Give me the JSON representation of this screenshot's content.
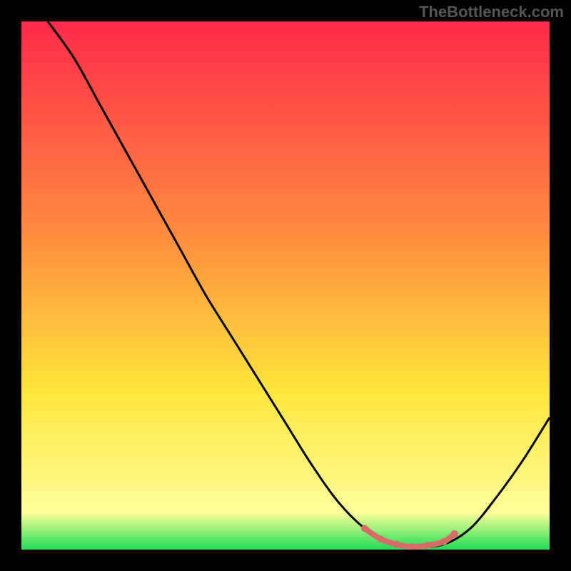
{
  "watermark": "TheBottleneck.com",
  "chart_data": {
    "type": "line",
    "title": "",
    "xlabel": "",
    "ylabel": "",
    "xlim": [
      0,
      100
    ],
    "ylim": [
      0,
      100
    ],
    "background_gradient": {
      "top": "#ff2a4a",
      "mid_orange": "#ff8b3e",
      "mid_yellow": "#ffe63c",
      "pale_yellow": "#ffff99",
      "bottom": "#1edd55"
    },
    "series": [
      {
        "name": "bottleneck-curve",
        "color": "#000000",
        "points": [
          {
            "x": 5,
            "y": 100
          },
          {
            "x": 10,
            "y": 93
          },
          {
            "x": 15,
            "y": 84
          },
          {
            "x": 20,
            "y": 75
          },
          {
            "x": 25,
            "y": 66
          },
          {
            "x": 30,
            "y": 57
          },
          {
            "x": 35,
            "y": 48
          },
          {
            "x": 40,
            "y": 40
          },
          {
            "x": 45,
            "y": 32
          },
          {
            "x": 50,
            "y": 24
          },
          {
            "x": 55,
            "y": 16
          },
          {
            "x": 60,
            "y": 9
          },
          {
            "x": 65,
            "y": 4
          },
          {
            "x": 70,
            "y": 1
          },
          {
            "x": 75,
            "y": 0.5
          },
          {
            "x": 80,
            "y": 1
          },
          {
            "x": 85,
            "y": 4
          },
          {
            "x": 90,
            "y": 10
          },
          {
            "x": 95,
            "y": 17
          },
          {
            "x": 100,
            "y": 25
          }
        ]
      },
      {
        "name": "optimal-zone",
        "color": "#d96a6a",
        "points": [
          {
            "x": 65,
            "y": 4
          },
          {
            "x": 68,
            "y": 2
          },
          {
            "x": 71,
            "y": 1
          },
          {
            "x": 74,
            "y": 0.5
          },
          {
            "x": 77,
            "y": 0.8
          },
          {
            "x": 80,
            "y": 1.5
          },
          {
            "x": 82,
            "y": 3
          }
        ]
      }
    ]
  }
}
